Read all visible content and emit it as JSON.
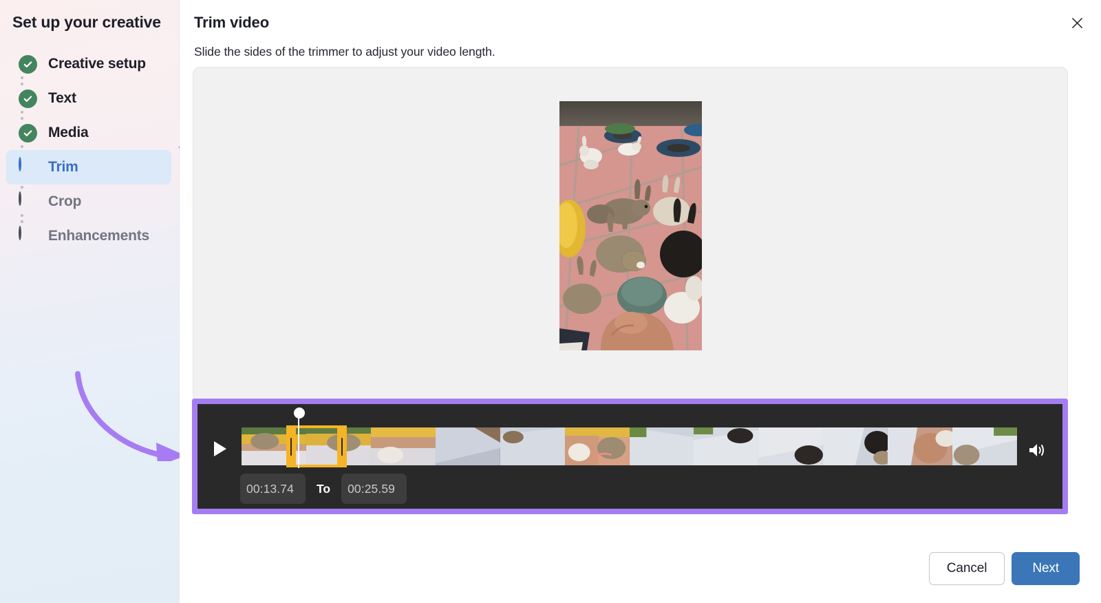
{
  "sidebar": {
    "title": "Set up your creative",
    "steps": [
      {
        "label": "Creative setup",
        "state": "complete",
        "icon": "check-circle-icon"
      },
      {
        "label": "Text",
        "state": "complete",
        "icon": "check-circle-icon"
      },
      {
        "label": "Media",
        "state": "complete",
        "icon": "check-circle-icon"
      },
      {
        "label": "Trim",
        "state": "active",
        "icon": "half-circle-icon"
      },
      {
        "label": "Crop",
        "state": "pending",
        "icon": "empty-circle-icon"
      },
      {
        "label": "Enhancements",
        "state": "pending",
        "icon": "empty-circle-icon"
      }
    ]
  },
  "main": {
    "title": "Trim video",
    "subtitle": "Slide the sides of the trimmer to adjust your video length.",
    "close_icon": "close-icon"
  },
  "timeline": {
    "play_icon": "play-icon",
    "volume_icon": "volume-high-icon",
    "start_time": "00:13.74",
    "end_time": "00:25.59",
    "separator_label": "To",
    "start_placeholder": "00:00.00",
    "end_placeholder": "00:00.00"
  },
  "footer": {
    "cancel_label": "Cancel",
    "next_label": "Next"
  },
  "colors": {
    "accent_purple": "#a47ef0",
    "trim_yellow": "#f5b325",
    "primary_blue": "#3a76b8",
    "active_blue": "#3b6fc4",
    "complete_green": "#43855f",
    "timeline_dark": "#292929"
  }
}
